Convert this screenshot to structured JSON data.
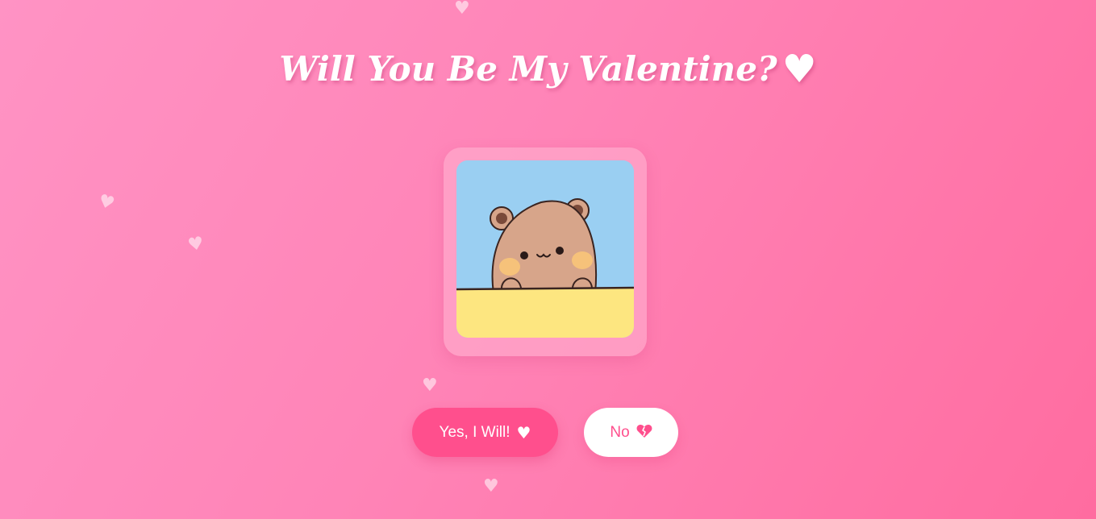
{
  "page": {
    "title": "Will You Be My Valentine?",
    "title_icon": "heart-icon"
  },
  "photo": {
    "subject": "bear-illustration"
  },
  "buttons": {
    "yes_label": "Yes, I Will!",
    "yes_icon": "heart-icon",
    "no_label": "No",
    "no_icon": "broken-heart-icon"
  },
  "colors": {
    "background_start": "#ff93c4",
    "background_end": "#ff6ca0",
    "accent": "#ff4f8d",
    "white": "#ffffff",
    "sky": "#9acff2",
    "table": "#fde680",
    "bear": "#d7a58a"
  },
  "decorations": {
    "floating_icon": "heart-icon"
  }
}
